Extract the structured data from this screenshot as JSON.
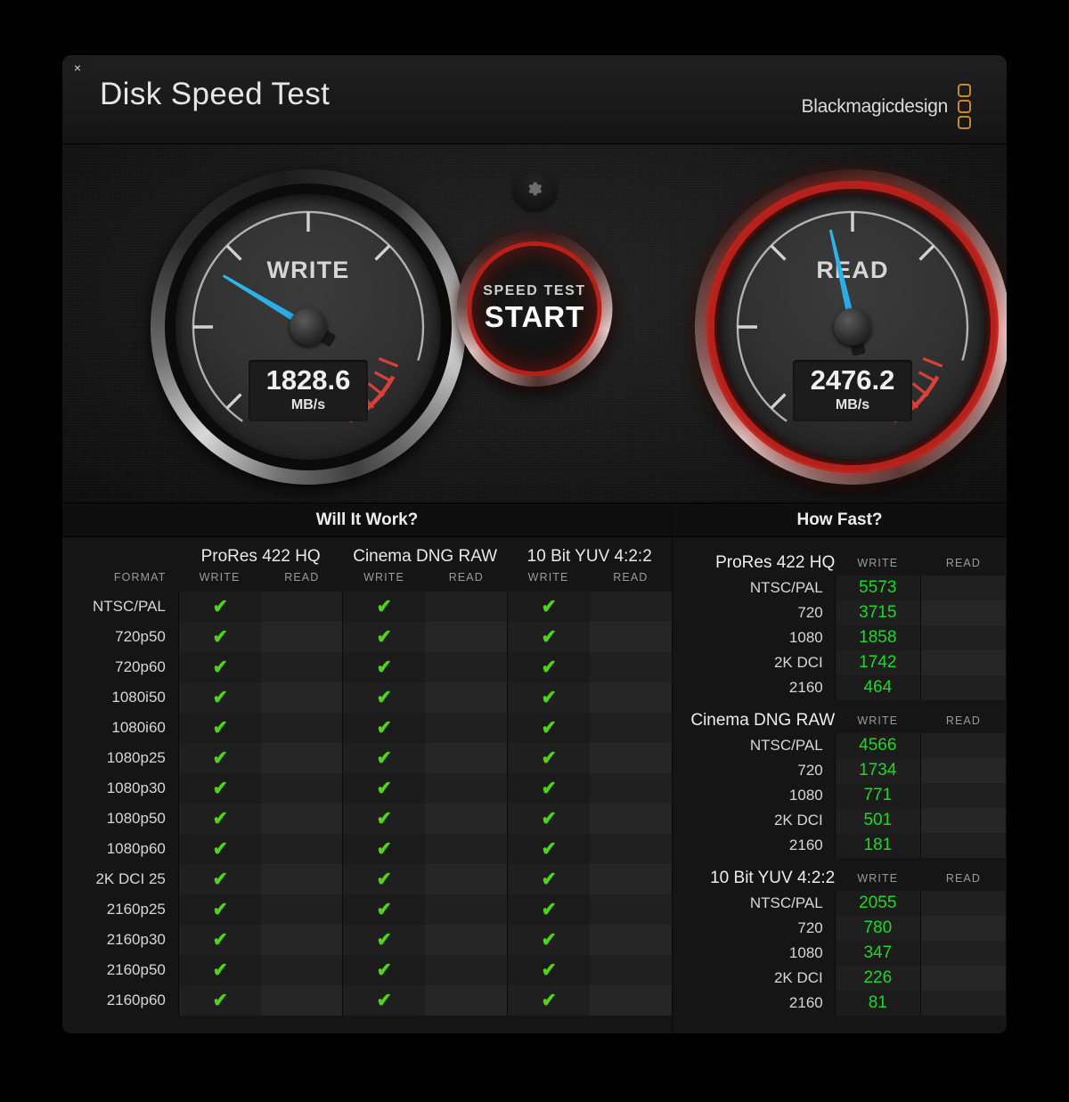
{
  "window": {
    "close_label": "×",
    "title": "Disk Speed Test",
    "brand": "Blackmagicdesign"
  },
  "gauges": {
    "write": {
      "label": "WRITE",
      "value": "1828.6",
      "unit": "MB/s",
      "needle_angle_deg": -59,
      "accent": "#28a9e2",
      "active": false
    },
    "read": {
      "label": "READ",
      "value": "2476.2",
      "unit": "MB/s",
      "needle_angle_deg": -13,
      "accent": "#28a9e2",
      "active": true,
      "ring_color": "#c0221b"
    }
  },
  "controls": {
    "gear_icon": "gear-icon",
    "start_top": "SPEED TEST",
    "start_main": "START"
  },
  "will_it_work": {
    "title": "Will It Work?",
    "format_header": "FORMAT",
    "codecs": [
      {
        "name": "ProRes 422 HQ",
        "write_header": "WRITE",
        "read_header": "READ"
      },
      {
        "name": "Cinema DNG RAW",
        "write_header": "WRITE",
        "read_header": "READ"
      },
      {
        "name": "10 Bit YUV 4:2:2",
        "write_header": "WRITE",
        "read_header": "READ"
      }
    ],
    "check_glyph": "✔",
    "check_color": "#4fd416",
    "rows": [
      {
        "format": "NTSC/PAL",
        "cells": [
          true,
          false,
          true,
          false,
          true,
          false
        ]
      },
      {
        "format": "720p50",
        "cells": [
          true,
          false,
          true,
          false,
          true,
          false
        ]
      },
      {
        "format": "720p60",
        "cells": [
          true,
          false,
          true,
          false,
          true,
          false
        ]
      },
      {
        "format": "1080i50",
        "cells": [
          true,
          false,
          true,
          false,
          true,
          false
        ]
      },
      {
        "format": "1080i60",
        "cells": [
          true,
          false,
          true,
          false,
          true,
          false
        ]
      },
      {
        "format": "1080p25",
        "cells": [
          true,
          false,
          true,
          false,
          true,
          false
        ]
      },
      {
        "format": "1080p30",
        "cells": [
          true,
          false,
          true,
          false,
          true,
          false
        ]
      },
      {
        "format": "1080p50",
        "cells": [
          true,
          false,
          true,
          false,
          true,
          false
        ]
      },
      {
        "format": "1080p60",
        "cells": [
          true,
          false,
          true,
          false,
          true,
          false
        ]
      },
      {
        "format": "2K DCI 25",
        "cells": [
          true,
          false,
          true,
          false,
          true,
          false
        ]
      },
      {
        "format": "2160p25",
        "cells": [
          true,
          false,
          true,
          false,
          true,
          false
        ]
      },
      {
        "format": "2160p30",
        "cells": [
          true,
          false,
          true,
          false,
          true,
          false
        ]
      },
      {
        "format": "2160p50",
        "cells": [
          true,
          false,
          true,
          false,
          true,
          false
        ]
      },
      {
        "format": "2160p60",
        "cells": [
          true,
          false,
          true,
          false,
          true,
          false
        ]
      }
    ]
  },
  "how_fast": {
    "title": "How Fast?",
    "value_color": "#1ed726",
    "groups": [
      {
        "name": "ProRes 422 HQ",
        "write_header": "WRITE",
        "read_header": "READ",
        "rows": [
          {
            "res": "NTSC/PAL",
            "write": "5573",
            "read": ""
          },
          {
            "res": "720",
            "write": "3715",
            "read": ""
          },
          {
            "res": "1080",
            "write": "1858",
            "read": ""
          },
          {
            "res": "2K DCI",
            "write": "1742",
            "read": ""
          },
          {
            "res": "2160",
            "write": "464",
            "read": ""
          }
        ]
      },
      {
        "name": "Cinema DNG RAW",
        "write_header": "WRITE",
        "read_header": "READ",
        "rows": [
          {
            "res": "NTSC/PAL",
            "write": "4566",
            "read": ""
          },
          {
            "res": "720",
            "write": "1734",
            "read": ""
          },
          {
            "res": "1080",
            "write": "771",
            "read": ""
          },
          {
            "res": "2K DCI",
            "write": "501",
            "read": ""
          },
          {
            "res": "2160",
            "write": "181",
            "read": ""
          }
        ]
      },
      {
        "name": "10 Bit YUV 4:2:2",
        "write_header": "WRITE",
        "read_header": "READ",
        "rows": [
          {
            "res": "NTSC/PAL",
            "write": "2055",
            "read": ""
          },
          {
            "res": "720",
            "write": "780",
            "read": ""
          },
          {
            "res": "1080",
            "write": "347",
            "read": ""
          },
          {
            "res": "2K DCI",
            "write": "226",
            "read": ""
          },
          {
            "res": "2160",
            "write": "81",
            "read": ""
          }
        ]
      }
    ]
  }
}
